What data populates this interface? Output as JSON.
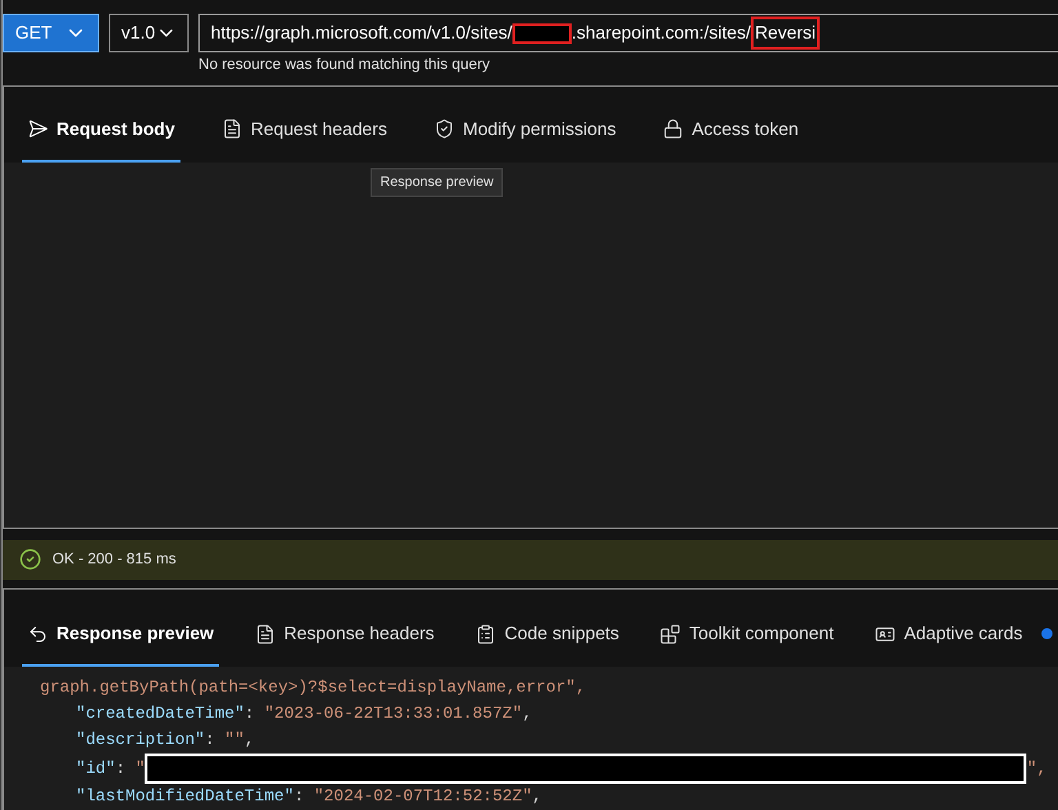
{
  "request_bar": {
    "method": "GET",
    "version": "v1.0",
    "url": [
      {
        "text": "https://graph.microsoft.com/v1.0/sites/",
        "kind": "plain"
      },
      {
        "kind": "redacted"
      },
      {
        "text": ".sharepoint.com:/sites/",
        "kind": "plain"
      },
      {
        "text": "Reversi",
        "kind": "highlighted"
      }
    ],
    "error": "No resource was found matching this query"
  },
  "request_tabs": [
    {
      "label": "Request body",
      "selected": true
    },
    {
      "label": "Request headers",
      "selected": false
    },
    {
      "label": "Modify permissions",
      "selected": false
    },
    {
      "label": "Access token",
      "selected": false
    }
  ],
  "tooltip": "Response preview",
  "status": {
    "text": "OK - 200 - 815 ms"
  },
  "response_tabs": [
    {
      "label": "Response preview",
      "selected": true,
      "dot": false
    },
    {
      "label": "Response headers",
      "selected": false,
      "dot": false
    },
    {
      "label": "Code snippets",
      "selected": false,
      "dot": false
    },
    {
      "label": "Toolkit component",
      "selected": false,
      "dot": false
    },
    {
      "label": "Adaptive cards",
      "selected": false,
      "dot": true
    }
  ],
  "code_lines": [
    {
      "tokens": [
        {
          "text": "graph.getByPath(path=<key>)?$select=displayName,error\",",
          "kind": "string"
        }
      ],
      "children": [
        {
          "tokens": [
            {
              "text": "\"createdDateTime\"",
              "kind": "key"
            },
            {
              "text": ": ",
              "kind": "punct"
            },
            {
              "text": "\"2023-06-22T13:33:01.857Z\"",
              "kind": "string"
            },
            {
              "text": ",",
              "kind": "punct"
            }
          ]
        },
        {
          "tokens": [
            {
              "text": "\"description\"",
              "kind": "key"
            },
            {
              "text": ": ",
              "kind": "punct"
            },
            {
              "text": "\"\"",
              "kind": "string"
            },
            {
              "text": ",",
              "kind": "punct"
            }
          ]
        },
        {
          "tokens": [
            {
              "text": "\"id\"",
              "kind": "key"
            },
            {
              "text": ": ",
              "kind": "punct"
            },
            {
              "text": "\"",
              "kind": "string"
            },
            {
              "kind": "redacted"
            },
            {
              "text": "\",",
              "kind": "string"
            }
          ]
        },
        {
          "tokens": [
            {
              "text": "\"lastModifiedDateTime\"",
              "kind": "key"
            },
            {
              "text": ": ",
              "kind": "punct"
            },
            {
              "text": "\"2024-02-07T12:52:52Z\"",
              "kind": "string"
            },
            {
              "text": ",",
              "kind": "punct"
            }
          ]
        }
      ]
    }
  ]
}
